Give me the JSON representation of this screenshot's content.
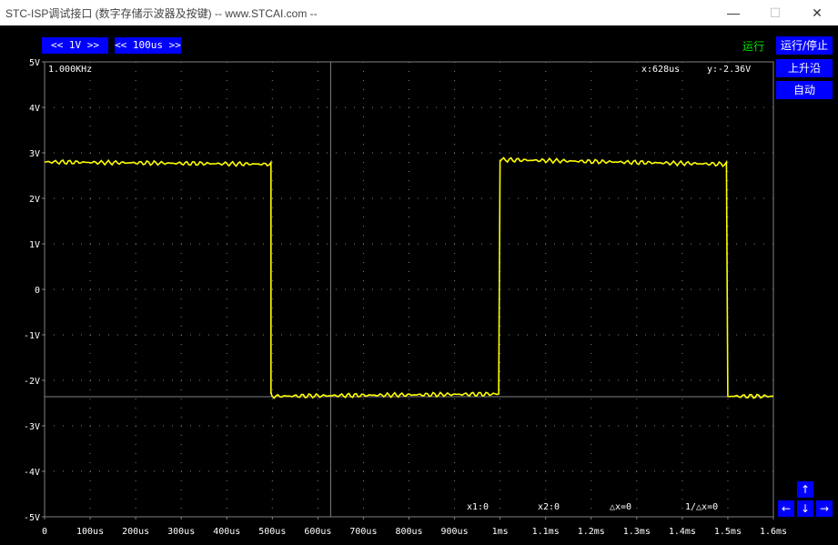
{
  "window": {
    "title": "STC-ISP调试接口 (数字存储示波器及按键) -- www.STCAI.com --",
    "minimize": "—",
    "maximize": "☐",
    "close": "✕"
  },
  "controls": {
    "volt_div": "<<   1V   >>",
    "time_div": "<< 100us >>",
    "status": "运行",
    "run_stop": "运行/停止",
    "rising_edge": "上升沿",
    "auto": "自动"
  },
  "readouts": {
    "frequency": "1.000KHz",
    "cursor_x": "x:628us",
    "cursor_y": "y:-2.36V",
    "x1": "x1:0",
    "x2": "x2:0",
    "dx": "△x=0",
    "inv_dx": "1/△x=0"
  },
  "nav": {
    "up": "↑",
    "down": "↓",
    "left": "←",
    "right": "→"
  },
  "colors": {
    "trace": "#ffff00",
    "grid": "#808080",
    "button": "#0000ff",
    "status": "#00e000"
  },
  "chart_data": {
    "type": "line",
    "y_ticks": [
      "5V",
      "4V",
      "3V",
      "2V",
      "1V",
      "0",
      "-1V",
      "-2V",
      "-3V",
      "-4V",
      "-5V"
    ],
    "x_ticks": [
      "0",
      "100us",
      "200us",
      "300us",
      "400us",
      "500us",
      "600us",
      "700us",
      "800us",
      "900us",
      "1ms",
      "1.1ms",
      "1.2ms",
      "1.3ms",
      "1.4ms",
      "1.5ms",
      "1.6ms"
    ],
    "xlim_us": [
      0,
      1600
    ],
    "ylim_v": [
      -5,
      5
    ],
    "cursor": {
      "x_us": 628,
      "y_v": -2.36
    },
    "series": [
      {
        "x": [
          0,
          497,
          497,
          500,
          997,
          1000,
          1497,
          1500,
          1600
        ],
        "y": [
          2.8,
          2.75,
          -2.3,
          -2.35,
          -2.3,
          2.85,
          2.75,
          -2.35,
          -2.35
        ]
      }
    ]
  }
}
